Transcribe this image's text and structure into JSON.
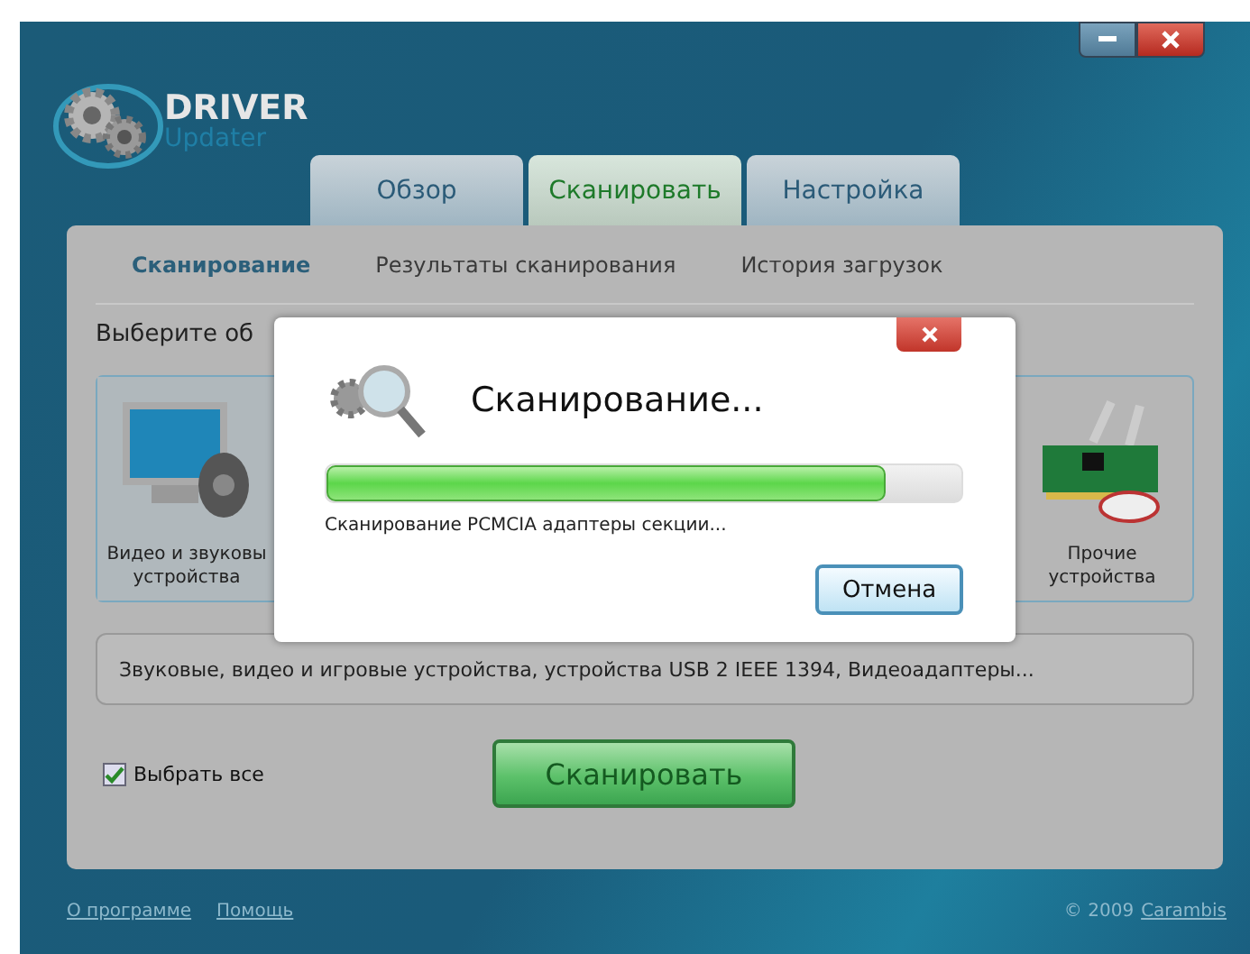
{
  "window": {
    "logo_main": "DRIVER",
    "logo_sub": "Updater"
  },
  "tabs": [
    {
      "label": "Обзор",
      "selected": false
    },
    {
      "label": "Сканировать",
      "selected": true
    },
    {
      "label": "Настройка",
      "selected": false
    }
  ],
  "subtabs": [
    {
      "label": "Сканирование",
      "selected": true
    },
    {
      "label": "Результаты сканирования",
      "selected": false
    },
    {
      "label": "История загрузок",
      "selected": false
    }
  ],
  "prompt": "Выберите об",
  "categories": [
    {
      "kind": "av",
      "lines": [
        "Видео и звуковы",
        "устройства"
      ],
      "selected": true
    },
    {
      "kind": "other",
      "lines": [
        "Прочие",
        "устройства"
      ],
      "selected": false
    }
  ],
  "description": "Звуковые, видео и игровые устройства, устройства USB 2 IEEE 1394, Видеоадаптеры...",
  "select_all": {
    "label": "Выбрать все",
    "checked": true
  },
  "scan_button": "Сканировать",
  "footer": {
    "links": [
      "О программе",
      "Помощь"
    ],
    "copyright": "© 2009",
    "brand": "Carambis"
  },
  "dialog": {
    "title": "Сканирование...",
    "level": 0.88,
    "status": "Сканирование PCMCIA адаптеры секции...",
    "cancel": "Отмена"
  }
}
